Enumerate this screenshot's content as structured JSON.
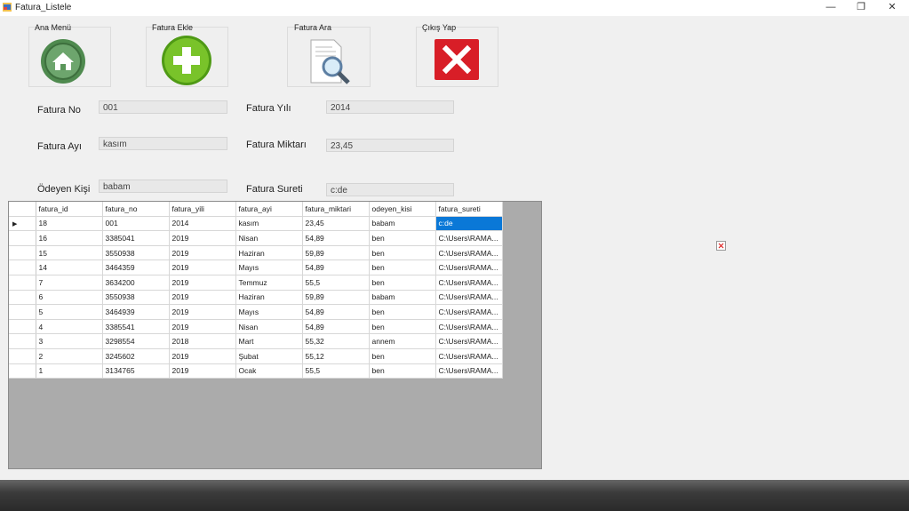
{
  "window": {
    "title": "Fatura_Listele",
    "minimize_glyph": "—",
    "maximize_glyph": "❐",
    "close_glyph": "✕"
  },
  "toolbar": {
    "home": {
      "label": "Ana Menü",
      "icon": "home-icon",
      "color": "#4f8a4f"
    },
    "add": {
      "label": "Fatura Ekle",
      "icon": "plus-icon",
      "color": "#5aa81c"
    },
    "search": {
      "label": "Fatura Ara",
      "icon": "document-search-icon"
    },
    "exit": {
      "label": "Çıkış Yap",
      "icon": "close-x-icon",
      "color": "#d81e27"
    }
  },
  "form": {
    "fatura_no": {
      "label": "Fatura No",
      "value": "001"
    },
    "fatura_ayi": {
      "label": "Fatura Ayı",
      "value": "kasım"
    },
    "odeyen_kisi": {
      "label": "Ödeyen Kişi",
      "value": "babam"
    },
    "fatura_yili": {
      "label": "Fatura Yılı",
      "value": "2014"
    },
    "fatura_miktari": {
      "label": "Fatura Miktarı",
      "value": "23,45"
    },
    "fatura_sureti": {
      "label": "Fatura Sureti",
      "value": "c:de"
    }
  },
  "grid": {
    "columns": [
      "fatura_id",
      "fatura_no",
      "fatura_yili",
      "fatura_ayi",
      "fatura_miktari",
      "odeyen_kisi",
      "fatura_sureti"
    ],
    "current_row_marker": "▶",
    "rows": [
      [
        "18",
        "001",
        "2014",
        "kasım",
        "23,45",
        "babam",
        "c:de"
      ],
      [
        "16",
        "3385041",
        "2019",
        "Nisan",
        "54,89",
        "ben",
        "C:\\Users\\RAMA..."
      ],
      [
        "15",
        "3550938",
        "2019",
        "Haziran",
        "59,89",
        "ben",
        "C:\\Users\\RAMA..."
      ],
      [
        "14",
        "3464359",
        "2019",
        "Mayıs",
        "54,89",
        "ben",
        "C:\\Users\\RAMA..."
      ],
      [
        "7",
        "3634200",
        "2019",
        "Temmuz",
        "55,5",
        "ben",
        "C:\\Users\\RAMA..."
      ],
      [
        "6",
        "3550938",
        "2019",
        "Haziran",
        "59,89",
        "babam",
        "C:\\Users\\RAMA..."
      ],
      [
        "5",
        "3464939",
        "2019",
        "Mayıs",
        "54,89",
        "ben",
        "C:\\Users\\RAMA..."
      ],
      [
        "4",
        "3385541",
        "2019",
        "Nisan",
        "54,89",
        "ben",
        "C:\\Users\\RAMA..."
      ],
      [
        "3",
        "3298554",
        "2018",
        "Mart",
        "55,32",
        "annem",
        "C:\\Users\\RAMA..."
      ],
      [
        "2",
        "3245602",
        "2019",
        "Şubat",
        "55,12",
        "ben",
        "C:\\Users\\RAMA..."
      ],
      [
        "1",
        "3134765",
        "2019",
        "Ocak",
        "55,5",
        "ben",
        "C:\\Users\\RAMA..."
      ]
    ]
  }
}
